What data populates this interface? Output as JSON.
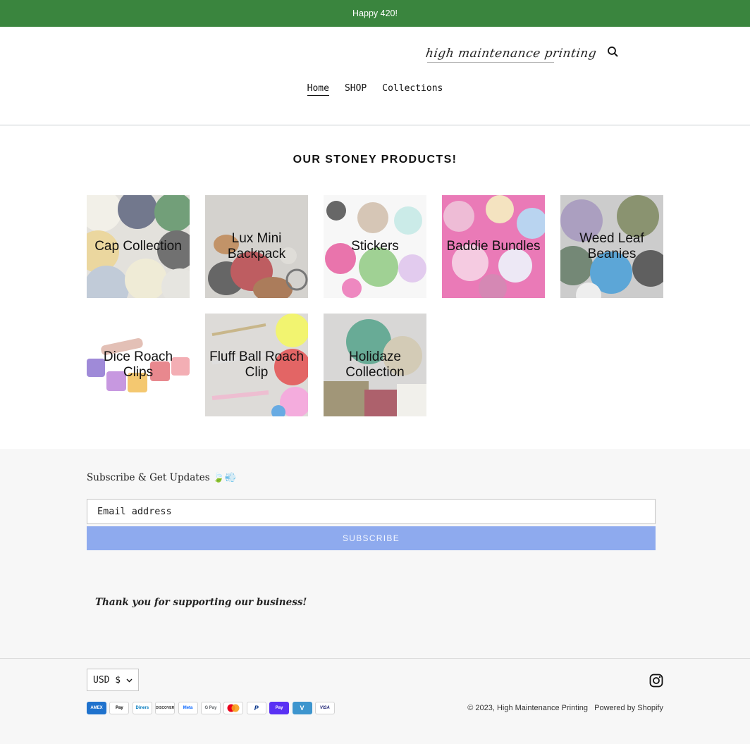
{
  "announcement": {
    "text": "Happy 420!"
  },
  "header": {
    "logo_text": "high maintenance printing",
    "nav": [
      {
        "label": "Home",
        "active": true
      },
      {
        "label": "SHOP",
        "active": false
      },
      {
        "label": "Collections",
        "active": false
      }
    ],
    "icons": {
      "search": "search-icon"
    }
  },
  "main": {
    "title": "OUR STONEY PRODUCTS!",
    "collections": [
      {
        "label": "Cap Collection"
      },
      {
        "label": "Lux Mini Backpack"
      },
      {
        "label": "Stickers"
      },
      {
        "label": "Baddie Bundles"
      },
      {
        "label": "Weed Leaf Beanies"
      },
      {
        "label": "Dice Roach Clips"
      },
      {
        "label": "Fluff Ball Roach Clip"
      },
      {
        "label": "Holidaze Collection"
      }
    ]
  },
  "footer": {
    "subscribe_heading": "Subscribe & Get Updates 🍃💨",
    "email_placeholder": "Email address",
    "subscribe_button": "SUBSCRIBE",
    "thank_you": "Thank you for supporting our business!",
    "currency": "USD $",
    "payment_methods": [
      "AMEX",
      "Pay",
      "Diners",
      "DISCOVER",
      "Meta",
      "G Pay",
      "mc",
      "P",
      "Pay",
      "V",
      "VISA"
    ],
    "copyright": "© 2023,",
    "store_name": "High Maintenance Printing",
    "powered_by": "Powered by Shopify",
    "icons": {
      "instagram": "instagram-icon",
      "currency_chevron": "chevron-down-icon"
    }
  },
  "colors": {
    "announcement_bg": "#3a853e",
    "subscribe_button_bg": "#8eaaee",
    "footer_bg": "#f7f7f7"
  }
}
